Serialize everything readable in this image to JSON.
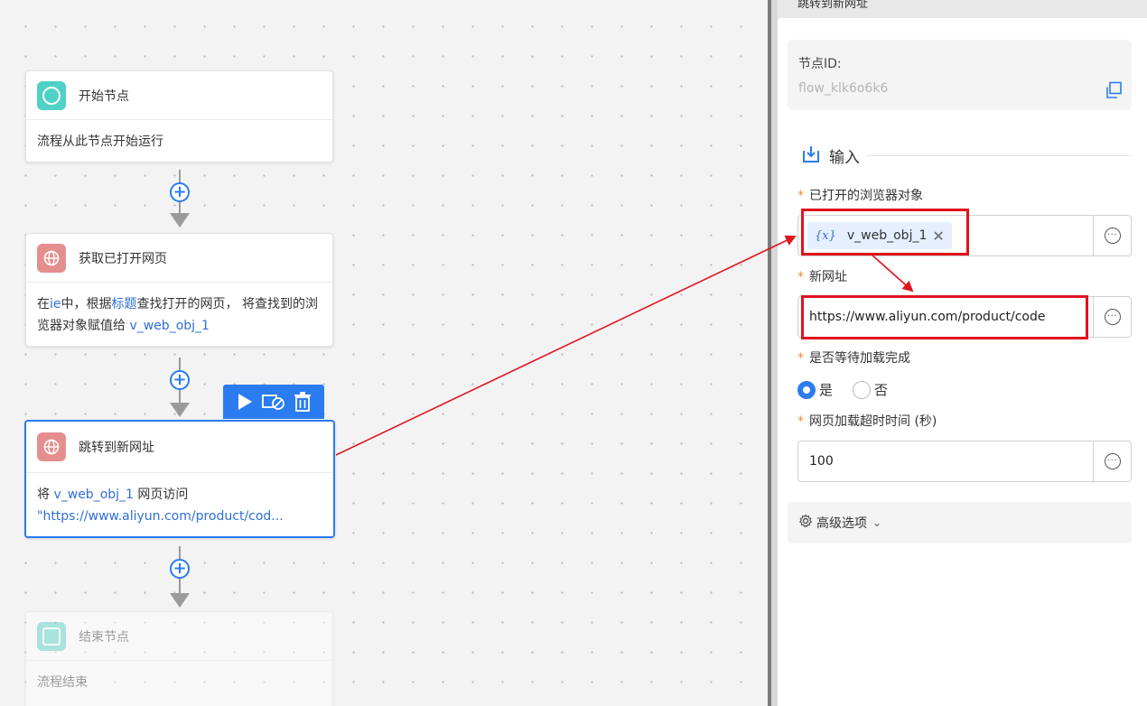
{
  "canvas": {
    "nodes": [
      {
        "title": "开始节点",
        "body": "流程从此节点开始运行"
      },
      {
        "title": "获取已打开网页",
        "body_pre": "在",
        "body_ie": "ie",
        "body_mid": "中，根据",
        "body_kw": "标题",
        "body_post": "查找打开的网页， 将查找到的浏览器对象赋值给 ",
        "body_var": "v_web_obj_1"
      },
      {
        "title": "跳转到新网址",
        "body_pre": "将 ",
        "body_var": "v_web_obj_1",
        "body_mid": " 网页访问",
        "body_url": "\"https://www.aliyun.com/product/cod..."
      },
      {
        "title": "结束节点",
        "body": "流程结束"
      }
    ],
    "toolbar": {
      "run": "play-icon",
      "disable": "disable-icon",
      "delete": "trash-icon"
    }
  },
  "panel": {
    "title": "跳转到新网址",
    "node_id_label": "节点ID:",
    "node_id_value": "flow_klk6o6k6",
    "section_input": "输入",
    "fields": {
      "browser_label": "已打开的浏览器对象",
      "browser_chip_prefix": "{x}",
      "browser_chip_value": "v_web_obj_1",
      "url_label": "新网址",
      "url_value": "https://www.aliyun.com/product/code",
      "wait_label": "是否等待加载完成",
      "wait_yes": "是",
      "wait_no": "否",
      "timeout_label": "网页加载超时时间 (秒)",
      "timeout_value": "100"
    },
    "advanced": "高级选项"
  },
  "colors": {
    "accent": "#2b7cf1",
    "annotation": "#e0141e"
  }
}
